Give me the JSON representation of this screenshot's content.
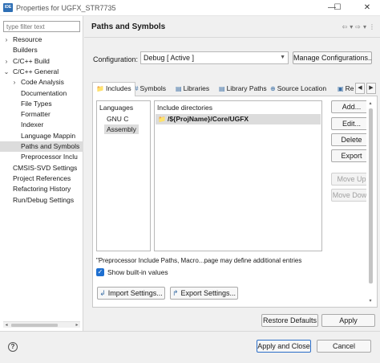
{
  "window": {
    "title": "Properties for UGFX_STR7735",
    "app_badge": "IDE",
    "controls": {
      "minimize": "—",
      "maximize": "☐",
      "close": "✕"
    }
  },
  "sidebar": {
    "filter_placeholder": "type filter text",
    "items": [
      {
        "label": "Resource",
        "level": 0,
        "expandable": true,
        "expanded": false,
        "selected": false
      },
      {
        "label": "Builders",
        "level": 0,
        "expandable": false,
        "selected": false
      },
      {
        "label": "C/C++ Build",
        "level": 0,
        "expandable": true,
        "expanded": false,
        "selected": false
      },
      {
        "label": "C/C++ General",
        "level": 0,
        "expandable": true,
        "expanded": true,
        "selected": false
      },
      {
        "label": "Code Analysis",
        "level": 1,
        "expandable": true,
        "expanded": false,
        "selected": false
      },
      {
        "label": "Documentation",
        "level": 1,
        "expandable": false,
        "selected": false
      },
      {
        "label": "File Types",
        "level": 1,
        "expandable": false,
        "selected": false
      },
      {
        "label": "Formatter",
        "level": 1,
        "expandable": false,
        "selected": false
      },
      {
        "label": "Indexer",
        "level": 1,
        "expandable": false,
        "selected": false
      },
      {
        "label": "Language Mappin",
        "level": 1,
        "expandable": false,
        "selected": false
      },
      {
        "label": "Paths and Symbols",
        "level": 1,
        "expandable": false,
        "selected": true
      },
      {
        "label": "Preprocessor Inclu",
        "level": 1,
        "expandable": false,
        "selected": false
      },
      {
        "label": "CMSIS-SVD Settings",
        "level": 0,
        "expandable": false,
        "selected": false
      },
      {
        "label": "Project References",
        "level": 0,
        "expandable": false,
        "selected": false
      },
      {
        "label": "Refactoring History",
        "level": 0,
        "expandable": false,
        "selected": false
      },
      {
        "label": "Run/Debug Settings",
        "level": 0,
        "expandable": false,
        "selected": false
      }
    ],
    "scroll_left": "◂",
    "scroll_right": "▸"
  },
  "page": {
    "title": "Paths and Symbols",
    "nav": {
      "back": "⇦",
      "back_menu": "▾",
      "forward": "⇨",
      "forward_menu": "▾",
      "menu": "⋮"
    }
  },
  "configuration": {
    "label": "Configuration:",
    "value": "Debug  [ Active ]",
    "manage_button": "Manage Configurations..."
  },
  "tabs": [
    {
      "label": "Includes",
      "icon": "📁",
      "active": true
    },
    {
      "label": "Symbols",
      "icon": "#",
      "active": false
    },
    {
      "label": "Libraries",
      "icon": "▤",
      "active": false
    },
    {
      "label": "Library Paths",
      "icon": "▤",
      "active": false
    },
    {
      "label": "Source Location",
      "icon": "⊕",
      "active": false
    },
    {
      "label": "Re",
      "icon": "▣",
      "active": false
    }
  ],
  "tab_scroll": {
    "left": "◀",
    "right": "▶"
  },
  "languages": {
    "header": "Languages",
    "items": [
      {
        "label": "GNU C",
        "selected": false
      },
      {
        "label": "Assembly",
        "selected": true
      }
    ]
  },
  "include_directories": {
    "header": "Include directories",
    "items": [
      {
        "label": "/${ProjName}/Core/UGFX",
        "icon": "📁",
        "selected": true
      }
    ]
  },
  "side_buttons": {
    "add": "Add...",
    "edit": "Edit...",
    "delete": "Delete",
    "export": "Export",
    "move_up": "Move Up",
    "move_down": "Move Down"
  },
  "note": "\"Preprocessor Include Paths, Macro...page may define additional entries",
  "show_builtin": {
    "label": "Show built-in values",
    "checked": true,
    "check_mark": "✓"
  },
  "import_button": {
    "label": "Import Settings...",
    "icon": "↲"
  },
  "export_button": {
    "label": "Export Settings...",
    "icon": "↱"
  },
  "restore_defaults": "Restore Defaults",
  "apply": "Apply",
  "footer": {
    "help": "?",
    "apply_and_close": "Apply and Close",
    "cancel": "Cancel"
  },
  "colors": {
    "selection": "#dcdcdc",
    "checkbox": "#1e6fd0",
    "primary_border": "#2b6ec7",
    "app_icon": "#2e6fb5"
  }
}
